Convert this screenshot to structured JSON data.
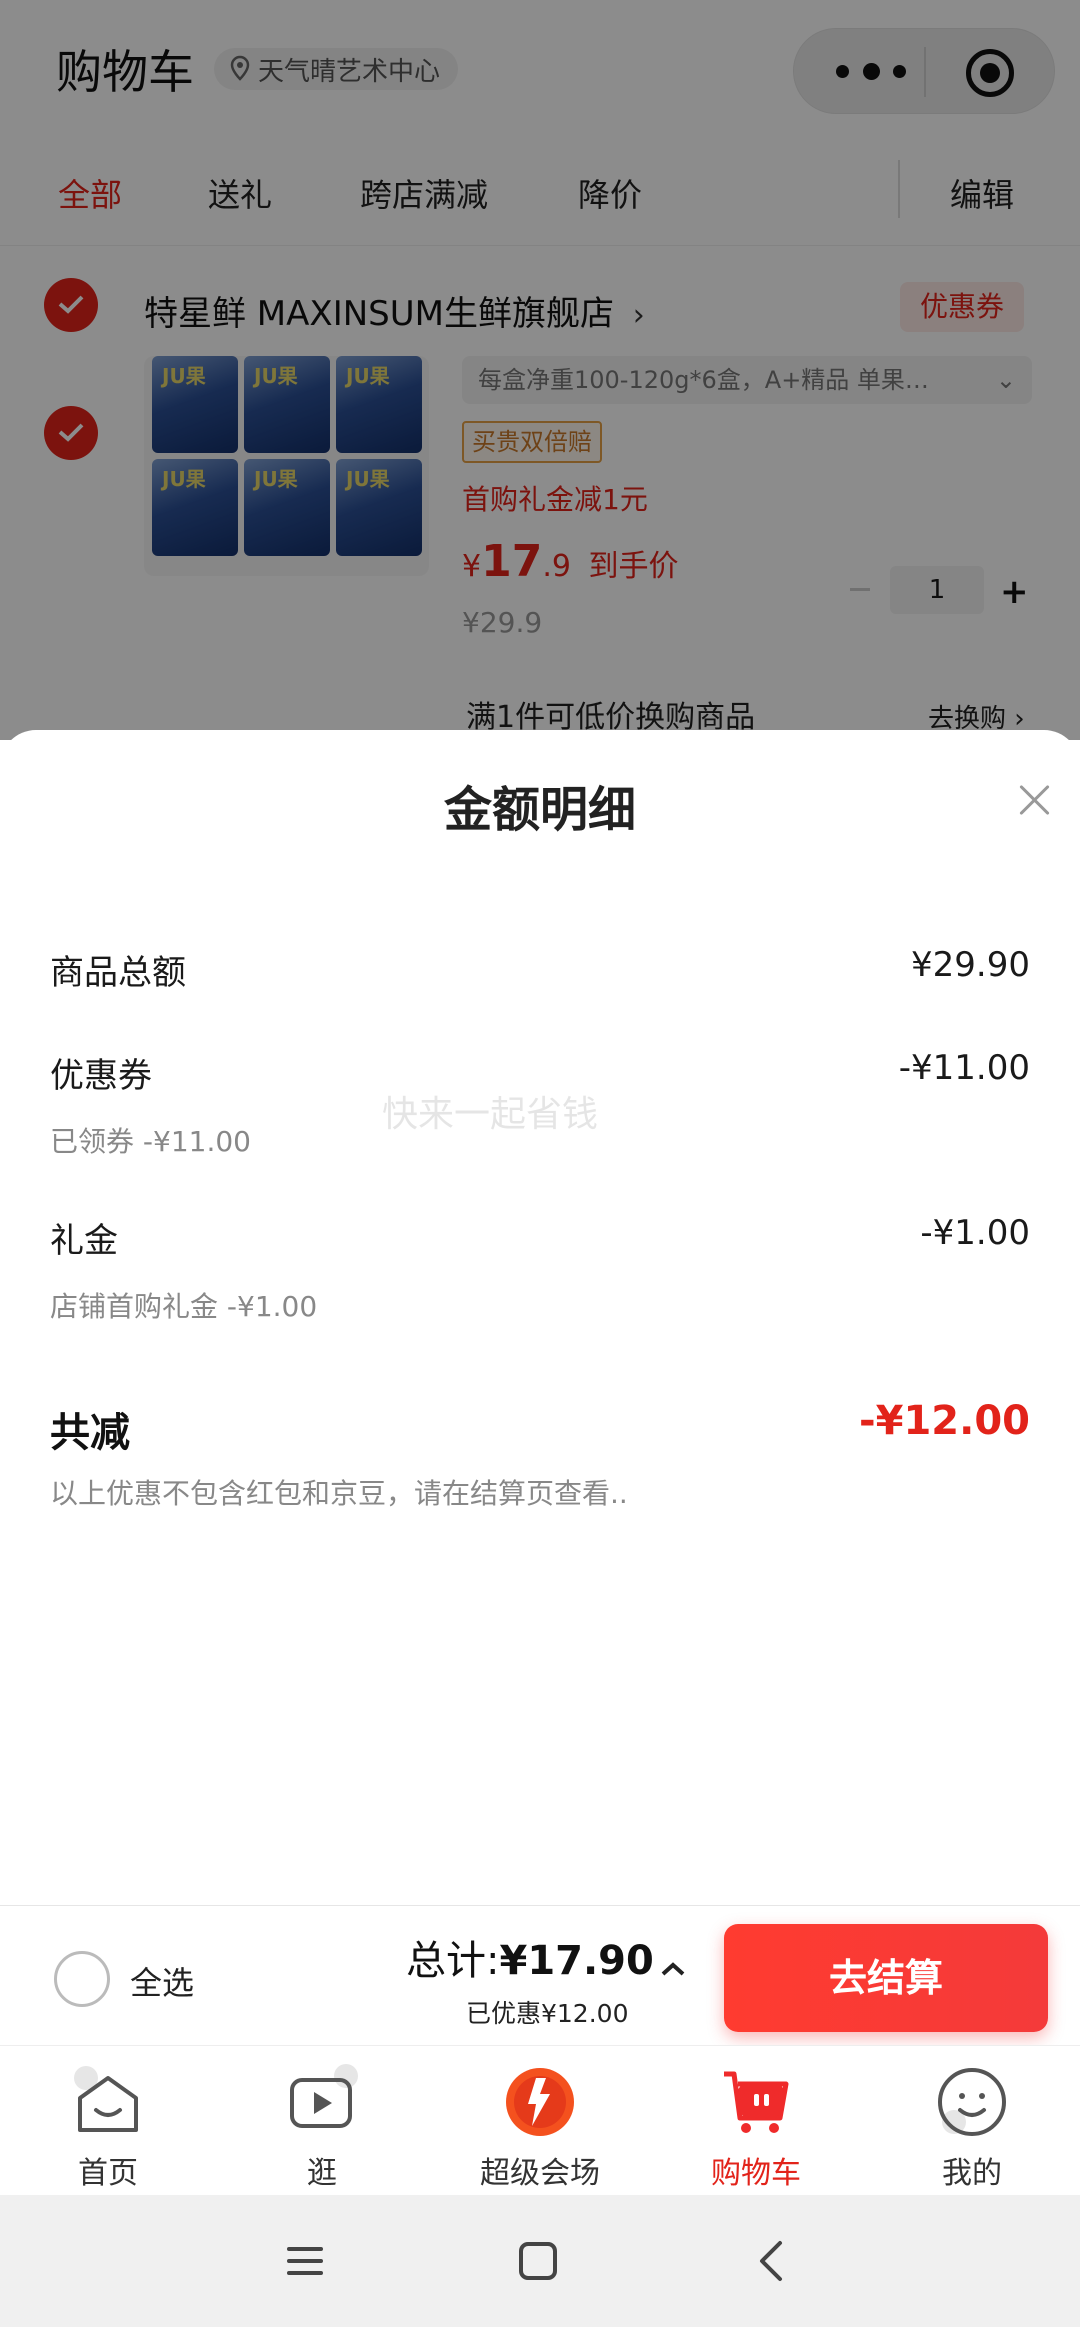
{
  "header": {
    "title": "购物车",
    "location": "天气晴艺术中心"
  },
  "tabs": [
    "全部",
    "送礼",
    "跨店满减",
    "降价"
  ],
  "edit_label": "编辑",
  "store": {
    "name": "特星鲜 MAXINSUM生鲜旗舰店",
    "coupon_tag": "优惠券",
    "product": {
      "spec": "每盒净重100-120g*6盒，A+精品 单果…",
      "tag": "买贵双倍赔",
      "first_buy": "首购礼金减1元",
      "price_symbol": "¥",
      "price_int": "17",
      "price_dec": ".9",
      "price_suffix": "到手价",
      "original_price": "¥29.9",
      "quantity": "1"
    },
    "exchange": {
      "text": "满1件可低价换购商品",
      "link": "去换购"
    }
  },
  "sheet": {
    "title": "金额明细",
    "watermark": "快来一起省钱",
    "rows": [
      {
        "label": "商品总额",
        "value": "¥29.90",
        "sub": ""
      },
      {
        "label": "优惠券",
        "value": "-¥11.00",
        "sub": "已领券 -¥11.00"
      },
      {
        "label": "礼金",
        "value": "-¥1.00",
        "sub": "店铺首购礼金 -¥1.00"
      }
    ],
    "total_label": "共减",
    "total_value": "-¥12.00",
    "note": "以上优惠不包含红包和京豆，请在结算页查看.."
  },
  "checkout": {
    "select_all": "全选",
    "total_prefix": "总计:",
    "total_value": "¥17.90",
    "saved": "已优惠¥12.00",
    "button": "去结算"
  },
  "tabbar": [
    {
      "label": "首页",
      "icon": "home-icon"
    },
    {
      "label": "逛",
      "icon": "video-icon"
    },
    {
      "label": "超级会场",
      "icon": "super-venue-icon"
    },
    {
      "label": "购物车",
      "icon": "cart-icon"
    },
    {
      "label": "我的",
      "icon": "profile-icon"
    }
  ],
  "colors": {
    "accent": "#e2231a",
    "button": "#ff3b30"
  }
}
